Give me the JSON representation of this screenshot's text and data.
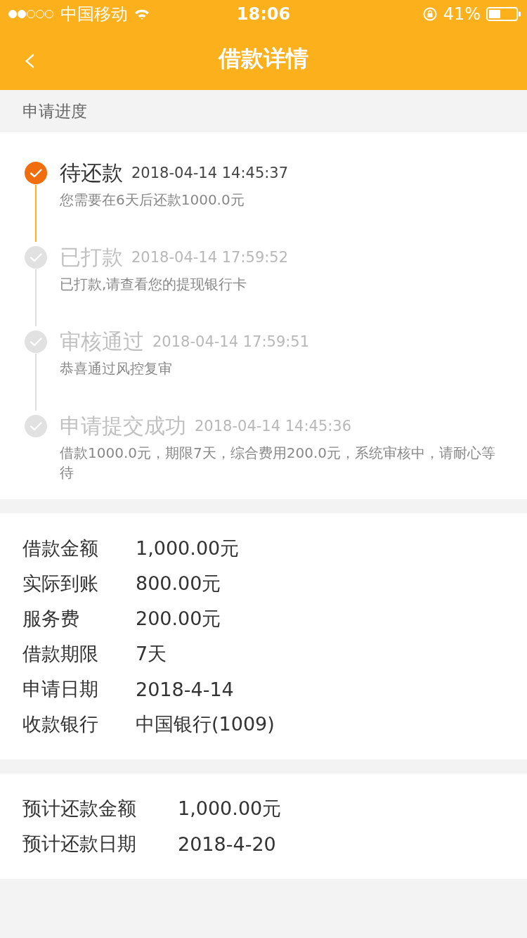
{
  "status_bar": {
    "carrier": "中国移动",
    "time": "18:06",
    "battery": "41%"
  },
  "nav": {
    "back": "‹",
    "title": "借款详情"
  },
  "progress_header": "申请进度",
  "timeline": [
    {
      "title": "待还款",
      "time": "2018-04-14 14:45:37",
      "desc": "您需要在6天后还款1000.0元",
      "active": true
    },
    {
      "title": "已打款",
      "time": "2018-04-14 17:59:52",
      "desc": "已打款,请查看您的提现银行卡",
      "active": false
    },
    {
      "title": "审核通过",
      "time": "2018-04-14 17:59:51",
      "desc": "恭喜通过风控复审",
      "active": false
    },
    {
      "title": "申请提交成功",
      "time": "2018-04-14 14:45:36",
      "desc": "借款1000.0元，期限7天，综合费用200.0元，系统审核中，请耐心等待",
      "active": false
    }
  ],
  "details": [
    {
      "label": "借款金额",
      "value": "1,000.00元"
    },
    {
      "label": "实际到账",
      "value": "800.00元"
    },
    {
      "label": "服务费",
      "value": "200.00元"
    },
    {
      "label": "借款期限",
      "value": "7天"
    },
    {
      "label": "申请日期",
      "value": "2018-4-14"
    },
    {
      "label": "收款银行",
      "value": "中国银行(1009)"
    }
  ],
  "repayment": [
    {
      "label": "预计还款金额",
      "value": "1,000.00元"
    },
    {
      "label": "预计还款日期",
      "value": "2018-4-20"
    }
  ]
}
